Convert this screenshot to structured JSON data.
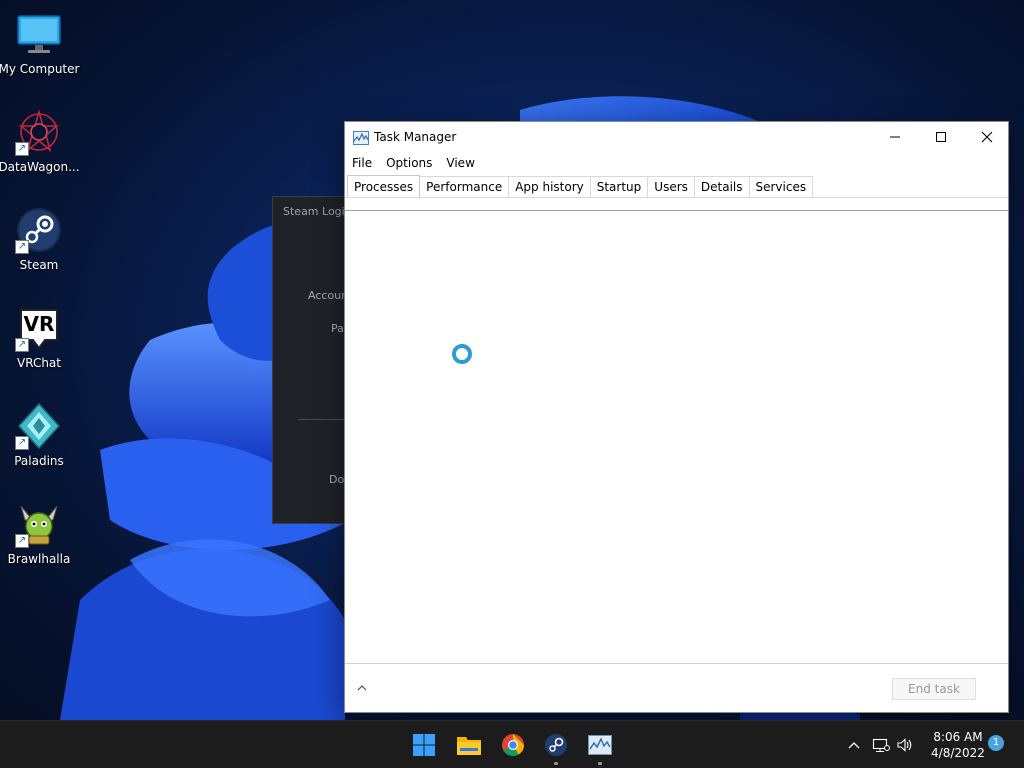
{
  "desktop": {
    "icons": [
      {
        "label": "My Computer",
        "icon": "monitor-icon",
        "shortcut": false
      },
      {
        "label": "DataWagon...",
        "icon": "datawagon-icon",
        "shortcut": true
      },
      {
        "label": "Steam",
        "icon": "steam-icon",
        "shortcut": true
      },
      {
        "label": "VRChat",
        "icon": "vrchat-icon",
        "shortcut": true,
        "glyph": "VR"
      },
      {
        "label": "Paladins",
        "icon": "paladins-icon",
        "shortcut": true
      },
      {
        "label": "Brawlhalla",
        "icon": "brawlhalla-icon",
        "shortcut": true
      }
    ],
    "shortcut_glyph": "↗"
  },
  "steam_login": {
    "title": "Steam Login",
    "account_label": "Accoun",
    "password_label": "Pa",
    "dont_label": "Do"
  },
  "task_manager": {
    "title": "Task Manager",
    "menu": [
      "File",
      "Options",
      "View"
    ],
    "tabs": [
      "Processes",
      "Performance",
      "App history",
      "Startup",
      "Users",
      "Details",
      "Services"
    ],
    "active_tab": "Processes",
    "end_task_label": "End task",
    "loading": true
  },
  "taskbar": {
    "apps": [
      "windows-start-icon",
      "file-explorer-icon",
      "chrome-icon",
      "steam-icon",
      "task-manager-icon"
    ],
    "clock_time": "8:06 AM",
    "clock_date": "4/8/2022",
    "notification_count": "1"
  },
  "colors": {
    "accent": "#2e9ad6",
    "taskbar": "#1c1c1c",
    "wallpaper_blue": "#1e5cf0"
  }
}
